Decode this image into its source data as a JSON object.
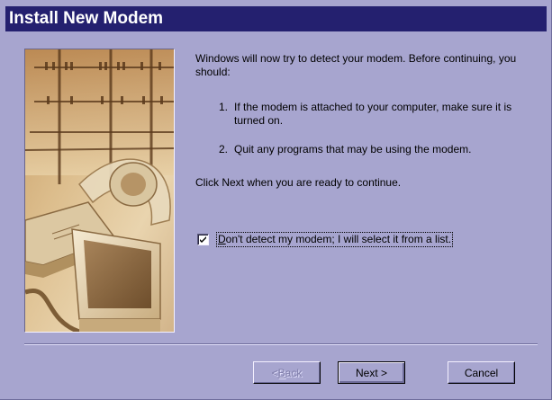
{
  "window": {
    "title": "Install New Modem"
  },
  "intro_text": "Windows will now try to detect your modem.  Before continuing, you should:",
  "steps": [
    {
      "number": "1.",
      "text": "If the modem is attached to your computer, make sure it is turned on."
    },
    {
      "number": "2.",
      "text": "Quit any programs that may be using the modem."
    }
  ],
  "continue_text": "Click Next when you are ready to continue.",
  "checkbox": {
    "checked": true,
    "label_prefix": "D",
    "label_rest": "on't detect my modem; I will select it from a list."
  },
  "buttons": {
    "back_prefix": "< ",
    "back_accel": "B",
    "back_rest": "ack",
    "next": "Next >",
    "cancel": "Cancel"
  },
  "colors": {
    "title_bar": "#24206f",
    "dialog_bg": "#a7a5cf",
    "disabled_text": "#7f7da9"
  },
  "icons": {
    "side_art": "modem-illustration"
  }
}
